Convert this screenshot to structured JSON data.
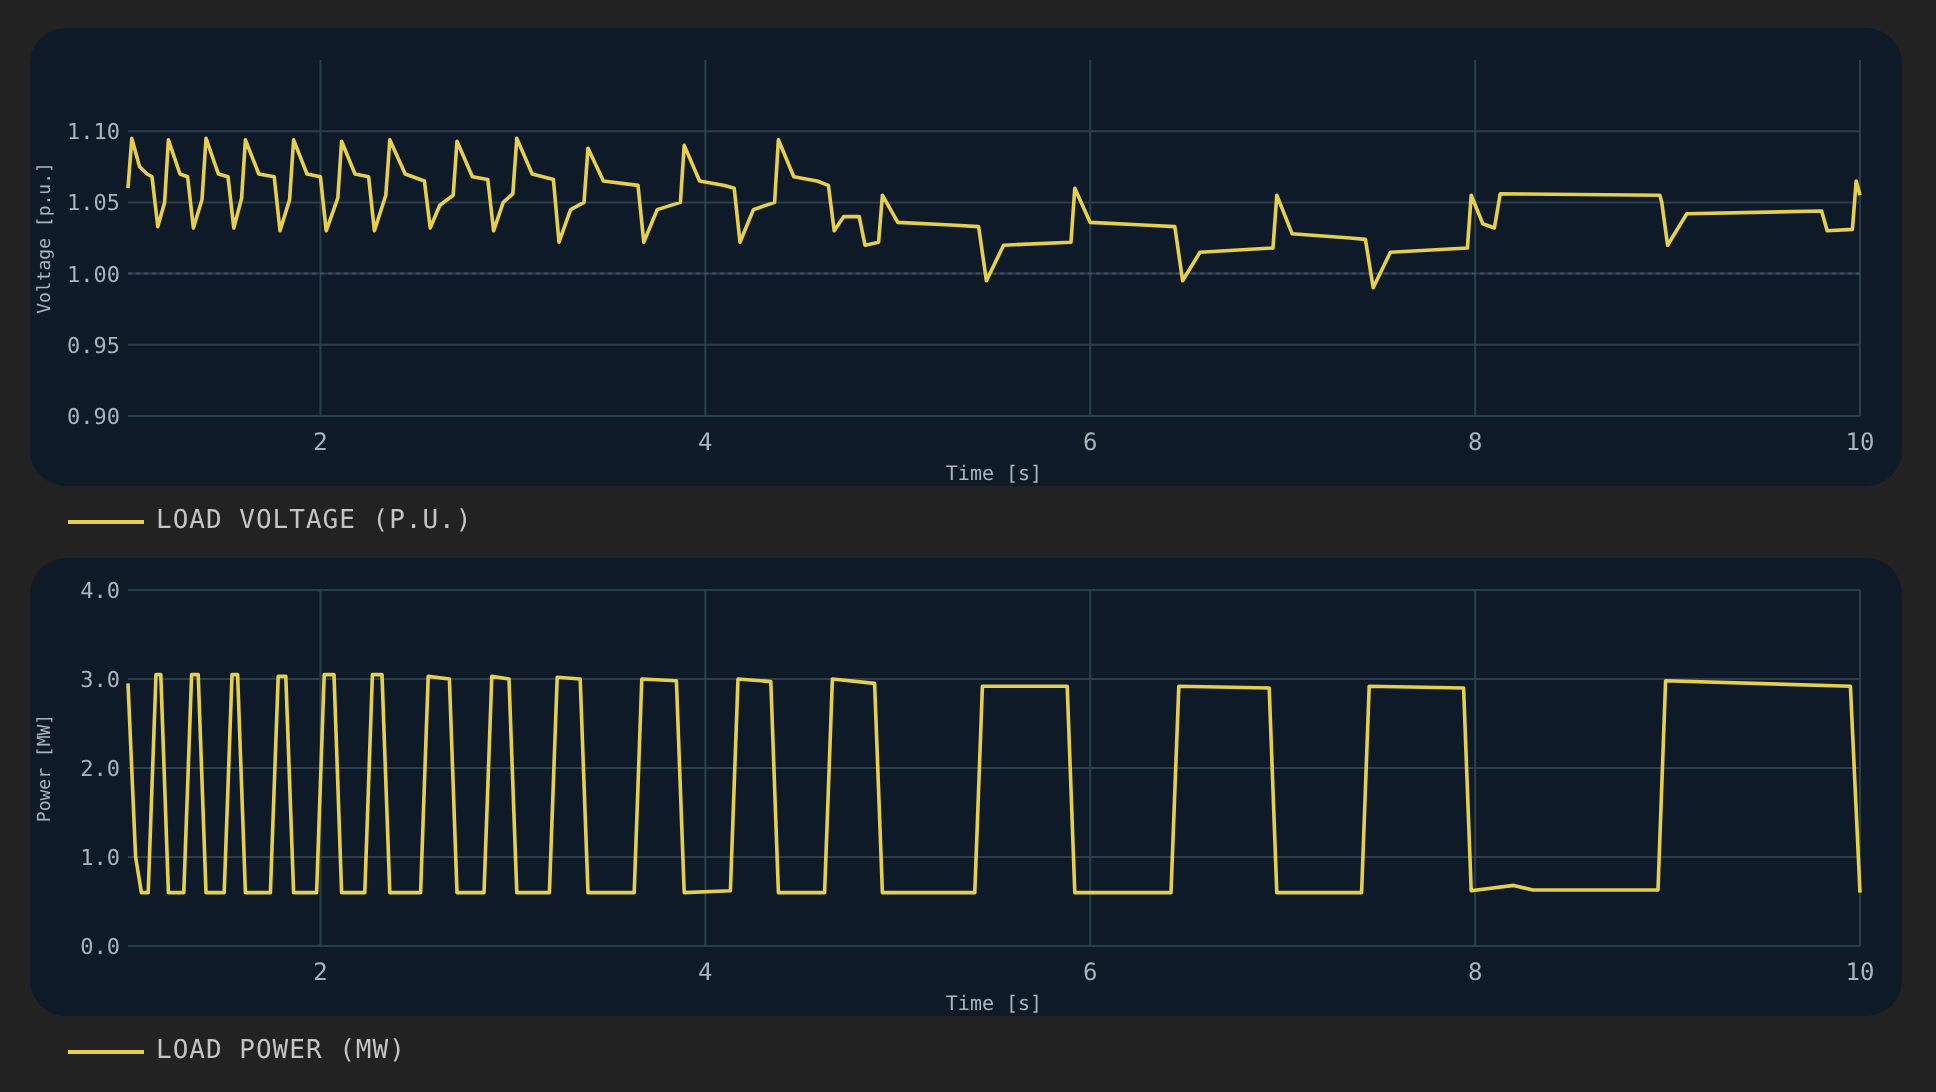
{
  "panels": [
    {
      "chart_data": {
        "type": "line",
        "xlabel": "Time [s]",
        "ylabel": "Voltage [p.u.]",
        "xlim": [
          1,
          10
        ],
        "ylim": [
          0.9,
          1.15
        ],
        "xticks": [
          2,
          4,
          6,
          8,
          10
        ],
        "yticks": [
          {
            "value": 0.9,
            "label": "0.90"
          },
          {
            "value": 0.95,
            "label": "0.95"
          },
          {
            "value": 1.0,
            "label": "1.00"
          },
          {
            "value": 1.05,
            "label": "1.05"
          },
          {
            "value": 1.1,
            "label": "1.10"
          }
        ],
        "grid": true,
        "ref_lines": [
          {
            "axis": "y",
            "value": 1.0
          }
        ],
        "x": [
          1.0,
          1.02,
          1.06,
          1.1,
          1.125,
          1.155,
          1.19,
          1.21,
          1.27,
          1.31,
          1.34,
          1.385,
          1.405,
          1.47,
          1.52,
          1.55,
          1.59,
          1.61,
          1.68,
          1.76,
          1.79,
          1.84,
          1.86,
          1.93,
          2.0,
          2.03,
          2.09,
          2.11,
          2.18,
          2.25,
          2.28,
          2.34,
          2.36,
          2.44,
          2.54,
          2.57,
          2.62,
          2.69,
          2.71,
          2.79,
          2.87,
          2.9,
          2.95,
          3.0,
          3.02,
          3.1,
          3.21,
          3.24,
          3.3,
          3.37,
          3.39,
          3.47,
          3.65,
          3.68,
          3.75,
          3.87,
          3.89,
          3.97,
          4.1,
          4.15,
          4.18,
          4.25,
          4.36,
          4.38,
          4.46,
          4.58,
          4.64,
          4.67,
          4.72,
          4.8,
          4.83,
          4.9,
          4.92,
          5.0,
          5.3,
          5.42,
          5.46,
          5.55,
          5.9,
          5.92,
          6.0,
          6.3,
          6.44,
          6.48,
          6.57,
          6.95,
          6.97,
          7.05,
          7.35,
          7.43,
          7.47,
          7.56,
          7.96,
          7.98,
          8.04,
          8.1,
          8.13,
          8.96,
          8.97,
          9.0,
          9.1,
          9.8,
          9.83,
          9.96,
          9.98,
          10.0
        ],
        "series": [
          {
            "name": "LOAD VOLTAGE (P.U.)",
            "color": "#e6cf4a",
            "values": [
              1.06,
              1.095,
              1.075,
              1.07,
              1.068,
              1.033,
              1.05,
              1.094,
              1.07,
              1.068,
              1.032,
              1.052,
              1.095,
              1.07,
              1.068,
              1.032,
              1.053,
              1.094,
              1.07,
              1.068,
              1.03,
              1.052,
              1.094,
              1.07,
              1.068,
              1.03,
              1.053,
              1.093,
              1.07,
              1.068,
              1.03,
              1.055,
              1.094,
              1.07,
              1.065,
              1.032,
              1.048,
              1.055,
              1.093,
              1.068,
              1.066,
              1.03,
              1.05,
              1.056,
              1.095,
              1.07,
              1.066,
              1.022,
              1.045,
              1.05,
              1.088,
              1.065,
              1.062,
              1.022,
              1.045,
              1.05,
              1.09,
              1.065,
              1.062,
              1.06,
              1.022,
              1.045,
              1.05,
              1.094,
              1.068,
              1.065,
              1.062,
              1.03,
              1.04,
              1.04,
              1.02,
              1.022,
              1.055,
              1.036,
              1.034,
              1.033,
              0.995,
              1.02,
              1.022,
              1.06,
              1.036,
              1.034,
              1.033,
              0.995,
              1.015,
              1.018,
              1.055,
              1.028,
              1.025,
              1.024,
              0.99,
              1.015,
              1.018,
              1.055,
              1.035,
              1.032,
              1.056,
              1.055,
              1.05,
              1.02,
              1.042,
              1.044,
              1.03,
              1.031,
              1.065,
              1.055
            ]
          }
        ]
      }
    },
    {
      "chart_data": {
        "type": "line",
        "grid": true,
        "xlabel": "Time [s]",
        "ylabel": "Power [MW]",
        "xlim": [
          1,
          10
        ],
        "ylim": [
          0,
          4
        ],
        "xticks": [
          2,
          4,
          6,
          8,
          10
        ],
        "yticks": [
          {
            "value": 0,
            "label": "0.0"
          },
          {
            "value": 1,
            "label": "1.0"
          },
          {
            "value": 2,
            "label": "2.0"
          },
          {
            "value": 3,
            "label": "3.0"
          },
          {
            "value": 4,
            "label": "4.0"
          }
        ],
        "x": [
          1.0,
          1.04,
          1.07,
          1.105,
          1.145,
          1.17,
          1.21,
          1.29,
          1.33,
          1.365,
          1.405,
          1.5,
          1.54,
          1.57,
          1.61,
          1.74,
          1.78,
          1.82,
          1.86,
          1.98,
          2.02,
          2.07,
          2.11,
          2.23,
          2.27,
          2.32,
          2.36,
          2.52,
          2.56,
          2.67,
          2.71,
          2.85,
          2.89,
          2.98,
          3.02,
          3.19,
          3.23,
          3.35,
          3.39,
          3.63,
          3.67,
          3.85,
          3.89,
          4.13,
          4.17,
          4.34,
          4.38,
          4.62,
          4.66,
          4.88,
          4.92,
          5.4,
          5.44,
          5.88,
          5.92,
          6.42,
          6.46,
          6.93,
          6.97,
          7.41,
          7.45,
          7.94,
          7.98,
          8.2,
          8.3,
          8.95,
          8.99,
          9.95,
          10.0
        ],
        "series": [
          {
            "name": "LOAD POWER (MW)",
            "color": "#e6cf4a",
            "values": [
              2.95,
              1.0,
              0.6,
              0.6,
              3.05,
              3.05,
              0.6,
              0.6,
              3.05,
              3.05,
              0.6,
              0.6,
              3.05,
              3.05,
              0.6,
              0.6,
              3.03,
              3.03,
              0.6,
              0.6,
              3.05,
              3.05,
              0.6,
              0.6,
              3.05,
              3.05,
              0.6,
              0.6,
              3.03,
              3.0,
              0.6,
              0.6,
              3.03,
              3.0,
              0.6,
              0.6,
              3.02,
              3.0,
              0.6,
              0.6,
              3.0,
              2.98,
              0.6,
              0.62,
              3.0,
              2.97,
              0.6,
              0.6,
              3.0,
              2.95,
              0.6,
              0.6,
              2.92,
              2.92,
              0.6,
              0.6,
              2.92,
              2.9,
              0.6,
              0.6,
              2.92,
              2.9,
              0.62,
              0.68,
              0.63,
              0.63,
              2.98,
              2.92,
              0.6
            ]
          }
        ]
      }
    }
  ]
}
